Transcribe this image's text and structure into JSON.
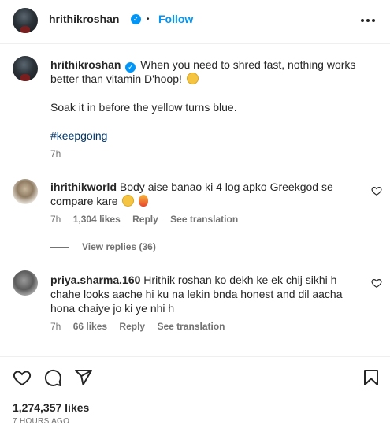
{
  "header": {
    "username": "hrithikroshan",
    "separator": "•",
    "follow_label": "Follow"
  },
  "caption": {
    "username": "hrithikroshan",
    "line1": "When you need to shred fast, nothing works",
    "line2": "better than vitamin D'hoop!",
    "line3": "Soak it in before the yellow turns blue.",
    "hashtag": "#keepgoing",
    "time": "7h"
  },
  "comments": [
    {
      "username": "ihrithikworld",
      "line1": "Body aise banao ki 4 log apko Greekgod se",
      "line2": "compare kare",
      "time": "7h",
      "likes": "1,304 likes",
      "reply_label": "Reply",
      "translation_label": "See translation",
      "view_replies": "View replies (36)"
    },
    {
      "username": "priya.sharma.160",
      "line1": "Hrithik roshan ko dekh ke ek chij sikhi h",
      "line2": "chahe looks aache hi ku na lekin bnda honest and dil aacha",
      "line3": "hona chaiye jo ki ye nhi h",
      "time": "7h",
      "likes": "66 likes",
      "reply_label": "Reply",
      "translation_label": "See translation"
    }
  ],
  "footer": {
    "likes": "1,274,357 likes",
    "ago": "7 HOURS AGO"
  },
  "icons": [
    "more-icon",
    "verified-icon",
    "heart-icon",
    "comment-icon",
    "share-icon",
    "save-icon"
  ],
  "colors": {
    "accent": "#0095f6",
    "text": "#262626",
    "muted": "#737373",
    "hashtag": "#00376b"
  }
}
